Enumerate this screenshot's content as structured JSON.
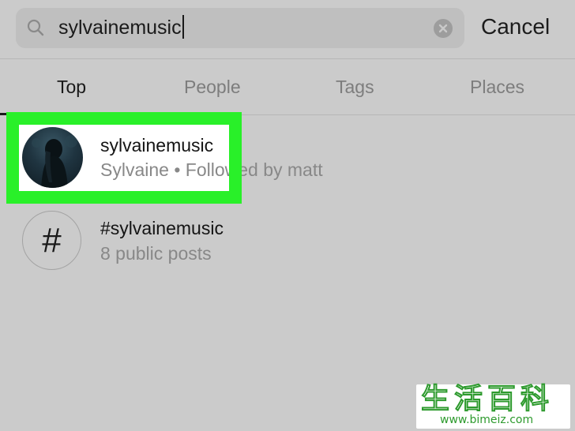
{
  "search": {
    "value": "sylvainemusic",
    "cancel_label": "Cancel"
  },
  "tabs": [
    {
      "label": "Top",
      "active": true
    },
    {
      "label": "People",
      "active": false
    },
    {
      "label": "Tags",
      "active": false
    },
    {
      "label": "Places",
      "active": false
    }
  ],
  "results": [
    {
      "type": "account",
      "title": "sylvainemusic",
      "subtitle": "Sylvaine • Followed by matt",
      "highlighted": true
    },
    {
      "type": "hashtag",
      "title": "#sylvainemusic",
      "subtitle": "8 public posts",
      "icon_glyph": "#"
    }
  ],
  "watermark": {
    "chars": "生活百科",
    "url": "www.bimeiz.com"
  },
  "colors": {
    "background": "#cbcbcb",
    "highlight": "#29f029",
    "watermark_green": "#2d9a2d"
  }
}
